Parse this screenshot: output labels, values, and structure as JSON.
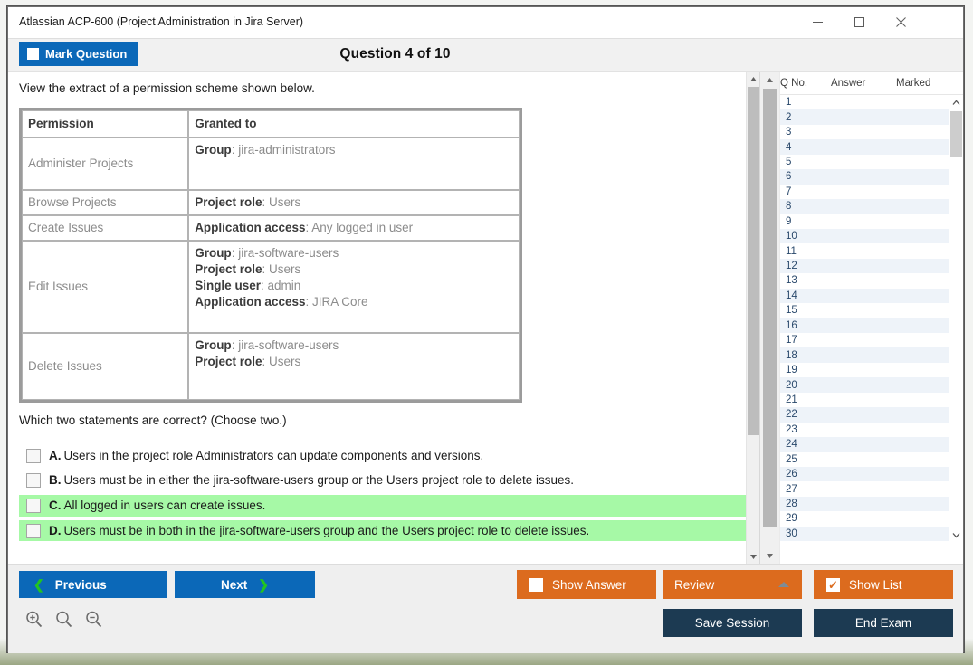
{
  "window": {
    "title": "Atlassian ACP-600 (Project Administration in Jira Server)",
    "minimize_icon": "minimize-icon",
    "maximize_icon": "maximize-icon",
    "close_icon": "close-icon"
  },
  "header": {
    "mark_question_label": "Mark Question",
    "question_counter": "Question 4 of 10"
  },
  "content": {
    "prompt": "View the extract of a permission scheme shown below.",
    "table": {
      "headers": [
        "Permission",
        "Granted to"
      ],
      "rows": [
        {
          "permission": "Administer Projects",
          "grants": [
            {
              "label": "Group",
              "value": "jira-administrators"
            }
          ]
        },
        {
          "permission": "Browse Projects",
          "grants": [
            {
              "label": "Project role",
              "value": "Users"
            }
          ]
        },
        {
          "permission": "Create Issues",
          "grants": [
            {
              "label": "Application access",
              "value": "Any logged in user"
            }
          ]
        },
        {
          "permission": "Edit Issues",
          "grants": [
            {
              "label": "Group",
              "value": "jira-software-users"
            },
            {
              "label": "Project role",
              "value": "Users"
            },
            {
              "label": "Single user",
              "value": "admin"
            },
            {
              "label": "Application access",
              "value": "JIRA Core"
            }
          ]
        },
        {
          "permission": "Delete Issues",
          "grants": [
            {
              "label": "Group",
              "value": "jira-software-users"
            },
            {
              "label": "Project role",
              "value": "Users"
            }
          ]
        }
      ]
    },
    "question_stem": "Which two statements are correct? (Choose two.)",
    "options": [
      {
        "letter": "A.",
        "text": "Users in the project role Administrators can update components and versions.",
        "correct": false,
        "checked": false
      },
      {
        "letter": "B.",
        "text": "Users must be in either the jira-software-users group or the Users project role to delete issues.",
        "correct": false,
        "checked": false
      },
      {
        "letter": "C.",
        "text": "All logged in users can create issues.",
        "correct": true,
        "checked": false
      },
      {
        "letter": "D.",
        "text": "Users must be in both in the jira-software-users group and the Users project role to delete issues.",
        "correct": true,
        "checked": false
      }
    ]
  },
  "question_list": {
    "columns": [
      "Q No.",
      "Answer",
      "Marked"
    ],
    "rows": [
      {
        "no": "1",
        "answer": "",
        "marked": ""
      },
      {
        "no": "2",
        "answer": "",
        "marked": ""
      },
      {
        "no": "3",
        "answer": "",
        "marked": ""
      },
      {
        "no": "4",
        "answer": "",
        "marked": ""
      },
      {
        "no": "5",
        "answer": "",
        "marked": ""
      },
      {
        "no": "6",
        "answer": "",
        "marked": ""
      },
      {
        "no": "7",
        "answer": "",
        "marked": ""
      },
      {
        "no": "8",
        "answer": "",
        "marked": ""
      },
      {
        "no": "9",
        "answer": "",
        "marked": ""
      },
      {
        "no": "10",
        "answer": "",
        "marked": ""
      },
      {
        "no": "11",
        "answer": "",
        "marked": ""
      },
      {
        "no": "12",
        "answer": "",
        "marked": ""
      },
      {
        "no": "13",
        "answer": "",
        "marked": ""
      },
      {
        "no": "14",
        "answer": "",
        "marked": ""
      },
      {
        "no": "15",
        "answer": "",
        "marked": ""
      },
      {
        "no": "16",
        "answer": "",
        "marked": ""
      },
      {
        "no": "17",
        "answer": "",
        "marked": ""
      },
      {
        "no": "18",
        "answer": "",
        "marked": ""
      },
      {
        "no": "19",
        "answer": "",
        "marked": ""
      },
      {
        "no": "20",
        "answer": "",
        "marked": ""
      },
      {
        "no": "21",
        "answer": "",
        "marked": ""
      },
      {
        "no": "22",
        "answer": "",
        "marked": ""
      },
      {
        "no": "23",
        "answer": "",
        "marked": ""
      },
      {
        "no": "24",
        "answer": "",
        "marked": ""
      },
      {
        "no": "25",
        "answer": "",
        "marked": ""
      },
      {
        "no": "26",
        "answer": "",
        "marked": ""
      },
      {
        "no": "27",
        "answer": "",
        "marked": ""
      },
      {
        "no": "28",
        "answer": "",
        "marked": ""
      },
      {
        "no": "29",
        "answer": "",
        "marked": ""
      },
      {
        "no": "30",
        "answer": "",
        "marked": ""
      }
    ]
  },
  "toolbar": {
    "previous_label": "Previous",
    "next_label": "Next",
    "show_answer_label": "Show Answer",
    "review_label": "Review",
    "show_list_label": "Show List",
    "save_session_label": "Save Session",
    "end_exam_label": "End Exam",
    "show_answer_checked": false,
    "show_list_checked": true,
    "zoom_in_icon": "zoom-in-icon",
    "zoom_reset_icon": "zoom-icon",
    "zoom_out_icon": "zoom-out-icon"
  },
  "colors": {
    "blue": "#0b68b8",
    "orange": "#dc6b1e",
    "navy": "#1c3a52",
    "correct_green": "#a6f9a6",
    "green_arrow": "#22c421"
  }
}
